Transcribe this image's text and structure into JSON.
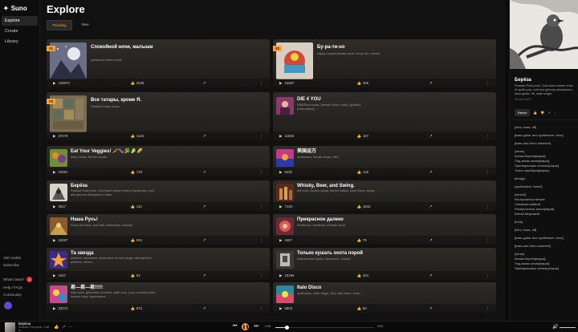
{
  "app": {
    "name": "Suno"
  },
  "sidebar": {
    "items": [
      {
        "label": "Explore",
        "active": true
      },
      {
        "label": "Create",
        "active": false
      },
      {
        "label": "Library",
        "active": false
      }
    ],
    "credits": "150 credits",
    "subscribe": "Subscribe",
    "whats_new": "What's New?",
    "whats_new_badge": "3",
    "help": "Help / FAQs",
    "community": "Community"
  },
  "page": {
    "title": "Explore",
    "tabs": [
      {
        "label": "Trending",
        "active": true
      },
      {
        "label": "New",
        "active": false
      }
    ]
  },
  "featured": [
    {
      "rank": "#1",
      "title": "Спокойной ночи, малыши",
      "desc": "symphonic black metal",
      "plays": "128670",
      "likes": "2646"
    },
    {
      "rank": "#2",
      "title": "Бу-ра-ти-но",
      "desc": "happy russian female voice, funny, fun, electro, ...",
      "plays": "15687",
      "likes": "266"
    },
    {
      "rank": "#3",
      "title": "Все татары, кроме Я.",
      "desc": "Russian Drake music",
      "plays": "37279",
      "likes": "1146"
    },
    {
      "rank": "",
      "title": "DIE 4 YOU",
      "desc": "R&B/Soul music, (female voice, male), (phonk), (Depressive), ...",
      "plays": "11556",
      "likes": "167"
    }
  ],
  "songs": [
    {
      "title": "Eat Your Veggies! 🥕🍆🥦🥬🌽",
      "desc": "deep house, female vocals",
      "plays": "33381",
      "likes": "729"
    },
    {
      "title": "美国运万",
      "desc": "synthwave, female singer, 80's",
      "plays": "643k",
      "likes": "148"
    },
    {
      "title": "Берёза",
      "desc": "Russian Post punk, Cold wave,darker ends of synth-pop, cold and gloomy atmosphere, bass...",
      "plays": "3917",
      "likes": "110"
    },
    {
      "title": "Whisky, Beer, and Swing.",
      "desc": "folk rock, electric swing, electro ballad, punk blues, swing, ...",
      "plays": "7128",
      "likes": "1843"
    },
    {
      "title": "Наша Русь!",
      "desc": "Drum and bass, rock folk, folktronica, dubstep",
      "plays": "34267",
      "likes": "834"
    },
    {
      "title": "Прекрасное далеко",
      "desc": "Deathcore, Hardcore, Female vocal",
      "plays": "3467",
      "likes": "79"
    },
    {
      "title": "Та звезда",
      "desc": "ambient, cyberpunk, synthwave, female singer, atmospheric, ambient, electro...",
      "plays": "2447",
      "likes": "83"
    },
    {
      "title": "Только кушать охота порой",
      "desc": "Instrumental Opera, Operacore, Classic",
      "plays": "10196",
      "likes": "344"
    },
    {
      "title": "君—君—君!!!!!",
      "desc": "lofty voice, glitch fest, troubled, math rock, j-pop, mutation funk, bounce drop, hyperspeed...",
      "plays": "33374",
      "likes": "873"
    },
    {
      "title": "Italo Disco",
      "desc": "synthwave, male singer, 80's, italo disco, drum...",
      "plays": "5803",
      "likes": "83"
    }
  ],
  "details": {
    "title": "Берёза",
    "desc": "Russian Post punk, Cold wave,darker ends of synth-pop, cold and gloomy atmosphere, bass guitar, riff, male singer",
    "date": "25 июн 2024",
    "remix": "Remix",
    "lyrics": [
      "[intro, bass, riff]",
      "",
      "[bass guitar and synthesizer, tune]",
      "",
      "[bass and drum machine]",
      "",
      "[verse]",
      "Белая Берёза[пауза]",
      "Под моим окном[пауза]",
      "Принакрылась снегом,[пауза]",
      "Точно серебром[пауза]",
      "",
      "[bridge]",
      "",
      "[synthesizer, tune2]",
      "",
      "[verse2]",
      "На пушистых ветках",
      "Снежною каймой",
      "Распустились кисти[пауза]",
      "Белой бахромой",
      "",
      "[tune]",
      "",
      "[intro, bass, riff]",
      "",
      "[bass guitar and synthesizer, tune]",
      "",
      "[bass and drum machine]",
      "",
      "[verse]",
      "Белая Берёза[пауза]",
      "Под моим окном[пауза]",
      "Принакрылась снегом,[пауза]"
    ]
  },
  "player": {
    "title": "Берёза",
    "subtitle": "Russian Post punk, Cold w...",
    "time_current": "0:36",
    "time_total": "3:52",
    "progress": 0.12
  },
  "colors": {
    "accent": "#f4a23a",
    "background": "#111111"
  }
}
